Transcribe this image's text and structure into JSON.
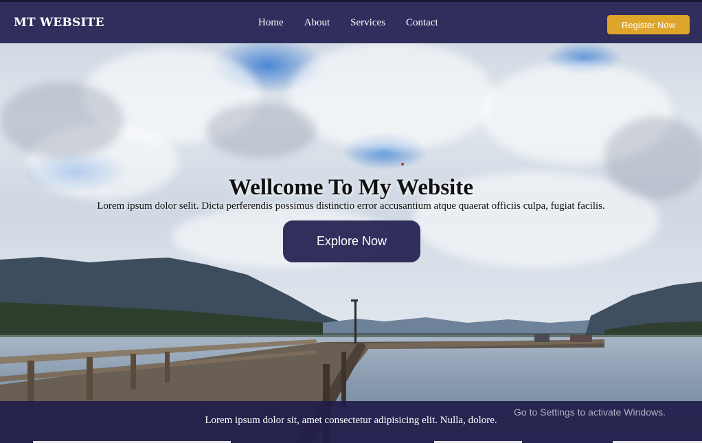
{
  "navbar": {
    "brand": "MT WEBSITE",
    "links": [
      "Home",
      "About",
      "Services",
      "Contact"
    ],
    "register_label": "Register Now"
  },
  "hero": {
    "title": "Wellcome To My Website",
    "subtitle": "Lorem ipsum dolor selit. Dicta perferendis possimus distinctio error accusantium atque quaerat officiis culpa, fugiat facilis.",
    "cta_label": "Explore Now"
  },
  "footer": {
    "text": "Lorem ipsum dolor sit, amet consectetur adipisicing elit. Nulla, dolore."
  },
  "system": {
    "watermark": "Go to Settings to activate Windows."
  },
  "colors": {
    "navbar_bg": "#242152",
    "accent": "#dfa52a",
    "button_bg": "#282454"
  }
}
